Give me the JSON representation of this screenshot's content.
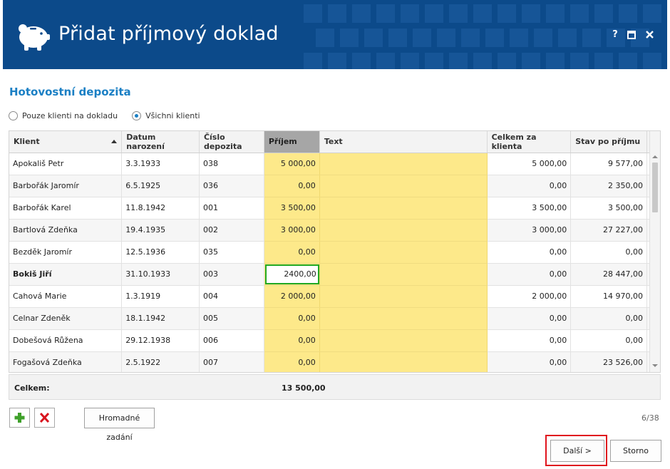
{
  "window": {
    "title": "Přidat příjmový doklad",
    "help_label": "?",
    "maximize_label": "▣",
    "close_label": "✕"
  },
  "section": {
    "title": "Hotovostní depozita"
  },
  "filter": {
    "options": [
      {
        "label": "Pouze klienti na dokladu",
        "selected": false
      },
      {
        "label": "Všichni klienti",
        "selected": true
      }
    ]
  },
  "table": {
    "columns": [
      "Klient",
      "Datum narození",
      "Číslo depozita",
      "Příjem",
      "Text",
      "Celkem za klienta",
      "Stav po příjmu"
    ],
    "rows": [
      {
        "klient": "Apokališ Petr",
        "datum": "3.3.1933",
        "cislo": "038",
        "prijem": "5 000,00",
        "text": "",
        "celkem": "5 000,00",
        "stav": "9 577,00"
      },
      {
        "klient": "Barbořák Jaromír",
        "datum": "6.5.1925",
        "cislo": "036",
        "prijem": "0,00",
        "text": "",
        "celkem": "0,00",
        "stav": "2 350,00"
      },
      {
        "klient": "Barbořák Karel",
        "datum": "11.8.1942",
        "cislo": "001",
        "prijem": "3 500,00",
        "text": "",
        "celkem": "3 500,00",
        "stav": "3 500,00"
      },
      {
        "klient": "Bartlová Zdeňka",
        "datum": "19.4.1935",
        "cislo": "002",
        "prijem": "3 000,00",
        "text": "",
        "celkem": "3 000,00",
        "stav": "27 227,00"
      },
      {
        "klient": "Bezděk Jaromír",
        "datum": "12.5.1936",
        "cislo": "035",
        "prijem": "0,00",
        "text": "",
        "celkem": "0,00",
        "stav": "0,00"
      },
      {
        "klient": "Bokiš Jiří",
        "datum": "31.10.1933",
        "cislo": "003",
        "prijem": "2400,00",
        "text": "",
        "celkem": "0,00",
        "stav": "28 447,00"
      },
      {
        "klient": "Cahová Marie",
        "datum": "1.3.1919",
        "cislo": "004",
        "prijem": "2 000,00",
        "text": "",
        "celkem": "2 000,00",
        "stav": "14 970,00"
      },
      {
        "klient": "Celnar Zdeněk",
        "datum": "18.1.1942",
        "cislo": "005",
        "prijem": "0,00",
        "text": "",
        "celkem": "0,00",
        "stav": "0,00"
      },
      {
        "klient": "Dobešová Růžena",
        "datum": "29.12.1938",
        "cislo": "006",
        "prijem": "0,00",
        "text": "",
        "celkem": "0,00",
        "stav": "0,00"
      },
      {
        "klient": "Fogašová Zdeňka",
        "datum": "2.5.1922",
        "cislo": "007",
        "prijem": "0,00",
        "text": "",
        "celkem": "0,00",
        "stav": "23 526,00"
      }
    ]
  },
  "totals": {
    "label": "Celkem:",
    "value": "13 500,00"
  },
  "toolbar": {
    "bulk_label": "Hromadné zadání"
  },
  "counter": "6/38",
  "footer": {
    "next_label": "Další >",
    "cancel_label": "Storno"
  },
  "colors": {
    "header_bg": "#0c4a8a",
    "accent": "#1a7fc4",
    "yellow_column": "#fde98a",
    "edit_border": "#22a822",
    "highlight": "#e0141e"
  }
}
